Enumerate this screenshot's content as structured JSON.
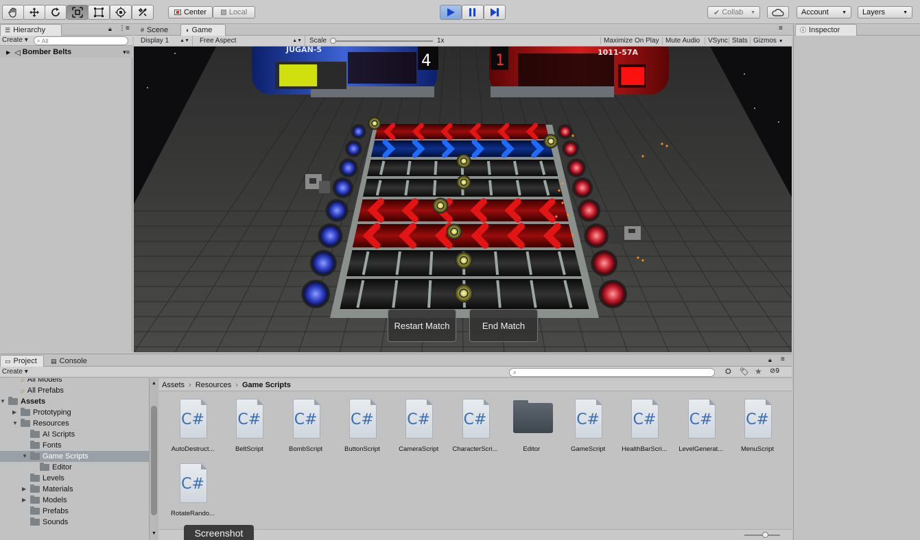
{
  "toolbar": {
    "tools": [
      "hand-tool-icon",
      "move-tool-icon",
      "rotate-tool-icon",
      "scale-tool-icon",
      "rect-tool-icon",
      "transform-tool-icon",
      "custom-tool-icon"
    ],
    "pivot_center": "Center",
    "pivot_local": "Local",
    "collab": "Collab",
    "account": "Account",
    "layers": "Layers"
  },
  "hierarchy": {
    "tab": "Hierarchy",
    "create": "Create",
    "search_placeholder": "All",
    "scene_name": "Bomber Belts"
  },
  "center_tabs": {
    "scene": "Scene",
    "game": "Game"
  },
  "game_toolbar": {
    "display": "Display 1",
    "aspect": "Free Aspect",
    "scale_label": "Scale",
    "scale_value": "1x",
    "maximize": "Maximize On Play",
    "mute": "Mute Audio",
    "vsync": "VSync",
    "stats": "Stats",
    "gizmos": "Gizmos"
  },
  "game": {
    "blue_score": "4",
    "red_score": "1",
    "blue_can_text": "JUGAN-5",
    "red_can_text": "1011-57A",
    "blue_health": 0.6,
    "red_health": 0.18,
    "restart_button": "Restart Match",
    "end_button": "End Match",
    "colors": {
      "blue": "#2b4fd6",
      "red": "#d31717",
      "belt_red": "#e31414",
      "belt_blue": "#1e6bff"
    }
  },
  "inspector": {
    "tab": "Inspector"
  },
  "project": {
    "tab_project": "Project",
    "tab_console": "Console",
    "create": "Create",
    "hidden_count": "9",
    "tree": [
      {
        "label": "All Models",
        "indent": 1,
        "icon": "search-icon"
      },
      {
        "label": "All Prefabs",
        "indent": 1,
        "icon": "search-icon"
      },
      {
        "label": "Assets",
        "indent": 0,
        "icon": "folder-icon",
        "bold": true,
        "expanded": true
      },
      {
        "label": "Prototyping",
        "indent": 1,
        "icon": "folder-icon",
        "arrow": "right"
      },
      {
        "label": "Resources",
        "indent": 1,
        "icon": "folder-icon",
        "arrow": "down"
      },
      {
        "label": "AI Scripts",
        "indent": 2,
        "icon": "folder-icon"
      },
      {
        "label": "Fonts",
        "indent": 2,
        "icon": "folder-icon"
      },
      {
        "label": "Game Scripts",
        "indent": 2,
        "icon": "folder-icon",
        "arrow": "down",
        "selected": true
      },
      {
        "label": "Editor",
        "indent": 3,
        "icon": "folder-icon"
      },
      {
        "label": "Levels",
        "indent": 2,
        "icon": "folder-icon"
      },
      {
        "label": "Materials",
        "indent": 2,
        "icon": "folder-icon",
        "arrow": "right"
      },
      {
        "label": "Models",
        "indent": 2,
        "icon": "folder-icon",
        "arrow": "right"
      },
      {
        "label": "Prefabs",
        "indent": 2,
        "icon": "folder-icon"
      },
      {
        "label": "Sounds",
        "indent": 2,
        "icon": "folder-icon"
      }
    ],
    "breadcrumb": [
      "Assets",
      "Resources",
      "Game Scripts"
    ],
    "assets": [
      {
        "name": "AutoDestruct...",
        "type": "cs"
      },
      {
        "name": "BeltScript",
        "type": "cs"
      },
      {
        "name": "BombScript",
        "type": "cs"
      },
      {
        "name": "ButtonScript",
        "type": "cs"
      },
      {
        "name": "CameraScript",
        "type": "cs"
      },
      {
        "name": "CharacterScri...",
        "type": "cs"
      },
      {
        "name": "Editor",
        "type": "folder"
      },
      {
        "name": "GameScript",
        "type": "cs"
      },
      {
        "name": "HealthBarScri...",
        "type": "cs"
      },
      {
        "name": "LevelGenerat...",
        "type": "cs"
      },
      {
        "name": "MenuScript",
        "type": "cs"
      },
      {
        "name": "RotateRando...",
        "type": "cs"
      }
    ],
    "cs_glyph": "C#"
  },
  "tooltip": "Screenshot"
}
